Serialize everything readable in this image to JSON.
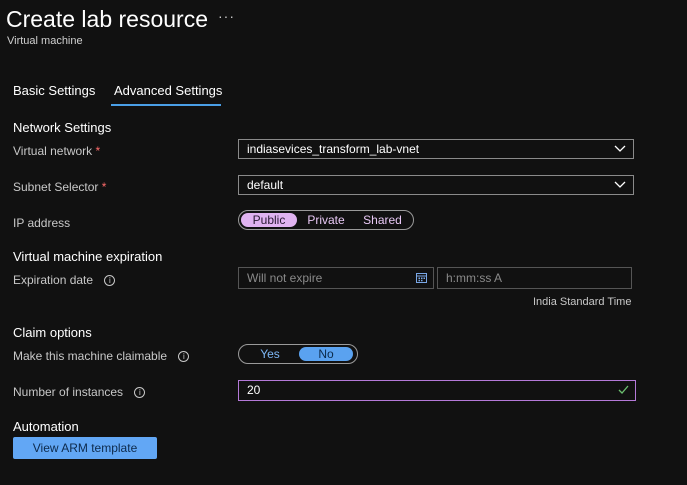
{
  "header": {
    "title": "Create lab resource",
    "more_label": "···",
    "subtitle": "Virtual machine"
  },
  "tabs": [
    {
      "label": "Basic Settings",
      "selected": false
    },
    {
      "label": "Advanced Settings",
      "selected": true
    }
  ],
  "network": {
    "section_title": "Network Settings",
    "vnet_label": "Virtual network",
    "vnet_value": "indiasevices_transform_lab-vnet",
    "subnet_label": "Subnet Selector",
    "subnet_value": "default",
    "required_mark": "*",
    "ip_label": "IP address",
    "ip_options": [
      "Public",
      "Private",
      "Shared"
    ],
    "ip_selected": "Public"
  },
  "expiration": {
    "section_title": "Virtual machine expiration",
    "date_label": "Expiration date",
    "date_placeholder": "Will not expire",
    "time_placeholder": "h:mm:ss A",
    "timezone": "India Standard Time"
  },
  "claim": {
    "section_title": "Claim options",
    "claimable_label": "Make this machine claimable",
    "options": [
      "Yes",
      "No"
    ],
    "selected": "No",
    "instances_label": "Number of instances",
    "instances_value": "20"
  },
  "automation": {
    "section_title": "Automation",
    "arm_button_label": "View ARM template"
  },
  "colors": {
    "background": "#111111",
    "accent": "#62a7f5",
    "ip_selected_bg": "#e0b3f0",
    "focus_border": "#b479d8",
    "required": "#ff6b6b"
  }
}
